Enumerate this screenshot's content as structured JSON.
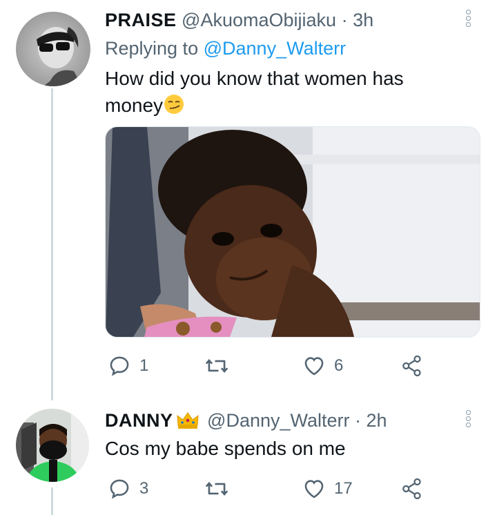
{
  "tweets": [
    {
      "name": "PRAISE",
      "handle": "@AkuomaObijiaku",
      "time": "· 3h",
      "replying_prefix": "Replying to",
      "replying_to": "@Danny_Walterr",
      "text": "How did you know that women has",
      "text_line2": "money",
      "emoji": "smirking-face-emoji",
      "media": "photo of smiling toddler with curly hair",
      "reply_count": "1",
      "retweet_count": "",
      "like_count": "6"
    },
    {
      "name": "DANNY",
      "badge": "crown-emoji",
      "handle": "@Danny_Walterr",
      "time": "· 2h",
      "text": "Cos my babe spends on me",
      "reply_count": "3",
      "retweet_count": "",
      "like_count": "17"
    }
  ],
  "colors": {
    "text": "#0f1419",
    "secondary": "#536471",
    "link": "#1d9bf0",
    "thread_line": "#cfd9de"
  }
}
